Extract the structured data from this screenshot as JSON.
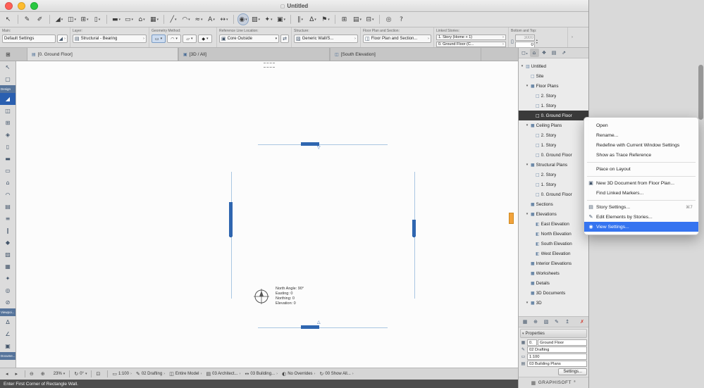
{
  "window": {
    "title": "Untitled",
    "traffic_lights": [
      "#ff5f57",
      "#febc2e",
      "#28c840"
    ]
  },
  "icons": {
    "doc": "▢",
    "chevron_right": "›",
    "chevron_down": "▾",
    "tri_down": "▾",
    "wall_glyph": "◢",
    "layer_ctrl": "▤",
    "core": "▣",
    "flip": "⇄",
    "hatch": "▨",
    "fps": "◫",
    "bt_wall": "▯",
    "spin_up": "▴",
    "spin_down": "▾",
    "folder_small": "▦",
    "pen_small": "✎",
    "scale_small": "▭",
    "layer_small": "▤"
  },
  "toolbar": {
    "buttons": [
      {
        "name": "arrow-tool-button",
        "glyph": "↖"
      },
      {
        "sep": true
      },
      {
        "name": "pick-up-parameters-button",
        "glyph": "✎"
      },
      {
        "name": "inject-parameters-button",
        "glyph": "✐"
      },
      {
        "sep": true
      },
      {
        "name": "wall-tool-button",
        "glyph": "◢",
        "chev": "▾"
      },
      {
        "name": "door-tool-button",
        "glyph": "◫",
        "chev": "▾"
      },
      {
        "name": "window-tool-button",
        "glyph": "⊞",
        "chev": "▾"
      },
      {
        "name": "column-tool-button",
        "glyph": "▯",
        "chev": "▾"
      },
      {
        "sep": true
      },
      {
        "name": "beam-tool-button",
        "glyph": "▬",
        "chev": "▾"
      },
      {
        "name": "slab-tool-button",
        "glyph": "▭",
        "chev": "▾"
      },
      {
        "name": "roof-tool-button",
        "glyph": "⌂",
        "chev": "▾"
      },
      {
        "name": "mesh-tool-button",
        "glyph": "▦",
        "chev": "▾"
      },
      {
        "sep": true
      },
      {
        "name": "line-tool-button",
        "glyph": "╱",
        "chev": "▾"
      },
      {
        "name": "arc-tool-button",
        "glyph": "◠",
        "chev": "▾"
      },
      {
        "name": "polyline-tool-button",
        "glyph": "≈",
        "chev": "▾"
      },
      {
        "name": "text-tool-button",
        "glyph": "A",
        "chev": "▾"
      },
      {
        "name": "dimension-tool-button",
        "glyph": "↔",
        "chev": "▾"
      },
      {
        "sep": true
      },
      {
        "name": "active-wall-mode-button",
        "glyph": "◉",
        "active": true,
        "chev": "▾"
      },
      {
        "name": "zone-tool-button",
        "glyph": "▨",
        "chev": "▾"
      },
      {
        "name": "object-tool-button",
        "glyph": "✦",
        "chev": "▾"
      },
      {
        "name": "camera-tool-button",
        "glyph": "▣",
        "chev": "▾"
      },
      {
        "sep": true
      },
      {
        "name": "section-marker-button",
        "glyph": "∥",
        "chev": "▾"
      },
      {
        "name": "elevation-marker-button",
        "glyph": "∆",
        "chev": "▾"
      },
      {
        "name": "marker-flag-button",
        "glyph": "⚑",
        "chev": "▾"
      },
      {
        "sep": true
      },
      {
        "name": "organizer-button",
        "glyph": "⊞"
      },
      {
        "name": "quick-layers-button",
        "glyph": "▤",
        "chev": "▾"
      },
      {
        "name": "grid-snap-button",
        "glyph": "⊟",
        "chev": "▾"
      },
      {
        "sep": true
      },
      {
        "name": "teamwork-button",
        "glyph": "◎"
      },
      {
        "name": "help-button",
        "glyph": "?"
      }
    ]
  },
  "infobox": {
    "main_label": "Main:",
    "default_settings": "Default Settings",
    "layer_label": "Layer:",
    "layer_value": "Structural - Bearing",
    "geometry_label": "Geometry Method:",
    "geometry_methods": [
      {
        "name": "geometry-straight-button",
        "glyph": "▭",
        "chev": "▾",
        "active": true
      },
      {
        "name": "geometry-curved-button",
        "glyph": "◠",
        "chev": "▾"
      },
      {
        "name": "geometry-trapezoid-button",
        "glyph": "▱",
        "chev": "▾"
      },
      {
        "name": "geometry-polygon-button",
        "glyph": "◆",
        "chev": "▾"
      }
    ],
    "refline_label": "Reference Line Location:",
    "refline_value": "Core Outside",
    "structure_label": "Structure:",
    "structure_value": "Generic Wall/S...",
    "fps_label": "Floor Plan and Section:",
    "fps_value": "Floor Plan and Section...",
    "linked_label": "Linked Stories:",
    "linked_top": "1. Story (Home + 1)",
    "linked_bottom": "0. Ground Floor (C...",
    "bt_label": "Bottom and Top:",
    "bt_top_value": "3000",
    "bt_bottom_value": "0"
  },
  "tabs": {
    "corner_glyph": "⊞",
    "items": [
      {
        "name": "tab-ground-floor",
        "label": "[0. Ground Floor]",
        "glyph": "▤",
        "active": true
      },
      {
        "name": "tab-3d-all",
        "label": "[3D / All]",
        "glyph": "▣"
      },
      {
        "name": "tab-south-elevation",
        "label": "[South Elevation]",
        "glyph": "◫"
      }
    ]
  },
  "toolbox": {
    "items": [
      {
        "name": "select-tool",
        "glyph": "↖"
      },
      {
        "name": "marquee-tool",
        "glyph": "▢"
      },
      {
        "label": "Design",
        "cls": "grp"
      },
      {
        "name": "wall-tool",
        "glyph": "◢",
        "active": true
      },
      {
        "name": "door-tool",
        "glyph": "◫"
      },
      {
        "name": "window-tool",
        "glyph": "⊞"
      },
      {
        "name": "skylight-tool",
        "glyph": "◈"
      },
      {
        "name": "column-tool",
        "glyph": "▯"
      },
      {
        "name": "beam-tool",
        "glyph": "▬"
      },
      {
        "name": "slab-tool",
        "glyph": "▭"
      },
      {
        "name": "roof-tool",
        "glyph": "⌂"
      },
      {
        "name": "shell-tool",
        "glyph": "◠"
      },
      {
        "name": "curtain-wall-tool",
        "glyph": "▤"
      },
      {
        "name": "stair-tool",
        "glyph": "≡"
      },
      {
        "name": "railing-tool",
        "glyph": "∥"
      },
      {
        "name": "morph-tool",
        "glyph": "◆"
      },
      {
        "name": "zone-tool",
        "glyph": "▨"
      },
      {
        "name": "mesh-tool",
        "glyph": "▦"
      },
      {
        "name": "object-tool",
        "glyph": "✦"
      },
      {
        "name": "lamp-tool",
        "glyph": "◎"
      },
      {
        "name": "opening-tool",
        "glyph": "⊘"
      },
      {
        "label": "Viewpoi...",
        "cls": "grp"
      },
      {
        "name": "section-tool",
        "glyph": "∆"
      },
      {
        "name": "elevation-tool",
        "glyph": "∠"
      },
      {
        "name": "camera-tool",
        "glyph": "▣"
      },
      {
        "label": "Docume...",
        "cls": "grp"
      }
    ]
  },
  "canvas": {
    "north": {
      "l1": "North Angle: 90°",
      "l2": "Easting: 0",
      "l3": "Northing: 0",
      "l4": "Elevation: 0"
    }
  },
  "navigator": {
    "header_icons": [
      {
        "name": "project-chooser-button",
        "glyph": "◻",
        "chev": "▸"
      },
      {
        "name": "project-map-button",
        "glyph": "⌂",
        "active": true
      },
      {
        "name": "view-map-button",
        "glyph": "❖"
      },
      {
        "name": "layout-book-button",
        "glyph": "▤"
      },
      {
        "name": "publisher-button",
        "glyph": "⇗"
      }
    ],
    "tree": [
      {
        "label": "Untitled",
        "level": 0,
        "arrow": "▾",
        "ig": "▥"
      },
      {
        "label": "Site",
        "level": 1,
        "arrow": "",
        "ig": "□"
      },
      {
        "label": "Floor Plans",
        "level": 1,
        "arrow": "▾",
        "ig": "■"
      },
      {
        "label": "2. Story",
        "level": 2,
        "arrow": "",
        "ig": "□"
      },
      {
        "label": "1. Story",
        "level": 2,
        "arrow": "",
        "ig": "□"
      },
      {
        "label": "0. Ground Floor",
        "level": 2,
        "arrow": "",
        "ig": "□",
        "selected": true
      },
      {
        "label": "Ceiling Plans",
        "level": 1,
        "arrow": "▾",
        "ig": "■"
      },
      {
        "label": "2. Story",
        "level": 2,
        "arrow": "",
        "ig": "□"
      },
      {
        "label": "1. Story",
        "level": 2,
        "arrow": "",
        "ig": "□"
      },
      {
        "label": "0. Ground Floor",
        "level": 2,
        "arrow": "",
        "ig": "□"
      },
      {
        "label": "Structural Plans",
        "level": 1,
        "arrow": "▾",
        "ig": "■"
      },
      {
        "label": "2. Story",
        "level": 2,
        "arrow": "",
        "ig": "□"
      },
      {
        "label": "1. Story",
        "level": 2,
        "arrow": "",
        "ig": "□"
      },
      {
        "label": "0. Ground Floor",
        "level": 2,
        "arrow": "",
        "ig": "□"
      },
      {
        "label": "Sections",
        "level": 1,
        "arrow": "",
        "ig": "■"
      },
      {
        "label": "Elevations",
        "level": 1,
        "arrow": "▾",
        "ig": "■"
      },
      {
        "label": "East Elevation",
        "level": 2,
        "arrow": "",
        "ig": "◧"
      },
      {
        "label": "North Elevation",
        "level": 2,
        "arrow": "",
        "ig": "◧"
      },
      {
        "label": "South Elevation",
        "level": 2,
        "arrow": "",
        "ig": "◧"
      },
      {
        "label": "West Elevation",
        "level": 2,
        "arrow": "",
        "ig": "◧"
      },
      {
        "label": "Interior Elevations",
        "level": 1,
        "arrow": "",
        "ig": "■"
      },
      {
        "label": "Worksheets",
        "level": 1,
        "arrow": "",
        "ig": "■"
      },
      {
        "label": "Details",
        "level": 1,
        "arrow": "",
        "ig": "■"
      },
      {
        "label": "3D Documents",
        "level": 1,
        "arrow": "",
        "ig": "■"
      },
      {
        "label": "3D",
        "level": 1,
        "arrow": "▾",
        "ig": "■"
      }
    ],
    "strip_icons": [
      {
        "name": "open-viewpoint-button",
        "glyph": "▦"
      },
      {
        "name": "save-view-button",
        "glyph": "⊕"
      },
      {
        "name": "new-folder-button",
        "glyph": "▧"
      },
      {
        "name": "edit-item-button",
        "glyph": "✎"
      },
      {
        "name": "import-button",
        "glyph": "↥"
      },
      {
        "name": "delete-item-button",
        "glyph": "✗",
        "cls": "red"
      }
    ],
    "properties": {
      "header": "Properties",
      "id": "0.",
      "name": "Ground Floor",
      "pen_set": "02 Drafting",
      "scale": "1:100",
      "layer_combination": "03 Building Plans",
      "settings_button": "Settings..."
    }
  },
  "context_menu": {
    "items": [
      {
        "label": "Open",
        "ig": ""
      },
      {
        "label": "Rename...",
        "ig": ""
      },
      {
        "label": "Redefine with Current Window Settings",
        "ig": ""
      },
      {
        "label": "Show as Trace Reference",
        "ig": ""
      },
      {
        "sep": true
      },
      {
        "label": "Place on Layout",
        "ig": ""
      },
      {
        "sep": true
      },
      {
        "label": "New 3D Document from Floor Plan...",
        "ig": "▣"
      },
      {
        "label": "Find Linked Markers...",
        "ig": ""
      },
      {
        "sep": true
      },
      {
        "label": "Story Settings...",
        "ig": "▤",
        "shortcut": "⌘7"
      },
      {
        "label": "Edit Elements by Stories...",
        "ig": "✎"
      },
      {
        "label": "View Settings...",
        "ig": "◉",
        "highlight": true
      }
    ]
  },
  "zoom_bar": {
    "items": [
      {
        "name": "history-back-button",
        "glyph": "◂"
      },
      {
        "name": "history-forward-button",
        "glyph": "▸"
      },
      {
        "sep": true
      },
      {
        "name": "zoom-out-button",
        "glyph": "⊖"
      },
      {
        "name": "zoom-in-button",
        "glyph": "⊕"
      },
      {
        "name": "zoom-level-control",
        "label": "23%",
        "chev": "▾"
      },
      {
        "sep": true
      },
      {
        "name": "orientation-control",
        "glyph": "↻",
        "label": "0°",
        "chev": "▾"
      },
      {
        "sep": true
      },
      {
        "name": "fit-in-window-button",
        "glyph": "⊡"
      },
      {
        "sep": true
      },
      {
        "name": "scale-control",
        "glyph": "▭",
        "label": "1:100",
        "chev": "›"
      },
      {
        "name": "pen-set-control",
        "glyph": "✎",
        "label": "02 Drafting",
        "chev": "›"
      },
      {
        "name": "model-filter-control",
        "glyph": "◫",
        "label": "Entire Model",
        "chev": "›"
      },
      {
        "name": "layer-combination-control",
        "glyph": "▤",
        "label": "03 Architect...",
        "chev": "›"
      },
      {
        "name": "dimension-style-control",
        "glyph": "↔",
        "label": "03 Building...",
        "chev": "›"
      },
      {
        "name": "overrides-control",
        "glyph": "◐",
        "label": "No Overrides",
        "chev": "›"
      },
      {
        "name": "renovation-filter-control",
        "glyph": "↻",
        "label": "00 Show All...",
        "chev": "›"
      }
    ]
  },
  "status_bar": {
    "message": "Enter First Corner of Rectangle Wall."
  },
  "branding": {
    "icon": "▦",
    "label": "GRAPHISOFT",
    "mark": "®"
  }
}
